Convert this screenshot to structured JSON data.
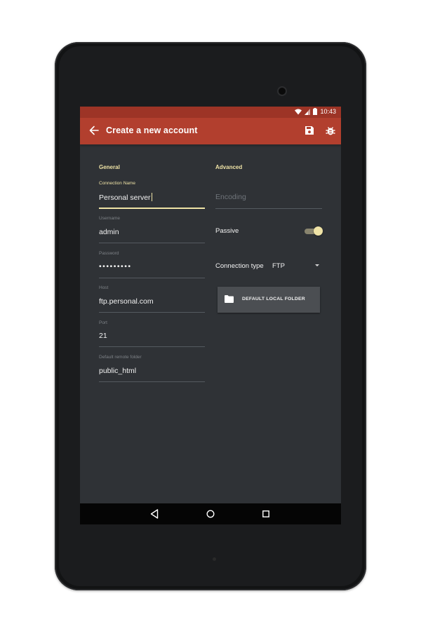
{
  "status_bar": {
    "time": "10:43"
  },
  "app_bar": {
    "title": "Create a new account",
    "back_icon": "arrow-back-icon",
    "save_icon": "save-icon",
    "debug_icon": "bug-icon"
  },
  "general": {
    "section_title": "General",
    "fields": [
      {
        "label": "Connection Name",
        "value": "Personal server",
        "focused": true
      },
      {
        "label": "Username",
        "value": "admin"
      },
      {
        "label": "Password",
        "value": "•••••••••"
      },
      {
        "label": "Host",
        "value": "ftp.personal.com"
      },
      {
        "label": "Port",
        "value": "21"
      },
      {
        "label": "Default remote folder",
        "value": "public_html"
      }
    ]
  },
  "advanced": {
    "section_title": "Advanced",
    "encoding_placeholder": "Encoding",
    "passive_label": "Passive",
    "passive_on": true,
    "connection_type_label": "Connection type",
    "connection_type_value": "FTP",
    "local_folder_button": "DEFAULT LOCAL FOLDER"
  },
  "colors": {
    "app_bar": "#b23f2e",
    "status_bar": "#9d3426",
    "accent": "#efe3a6",
    "background": "#2f3236"
  }
}
